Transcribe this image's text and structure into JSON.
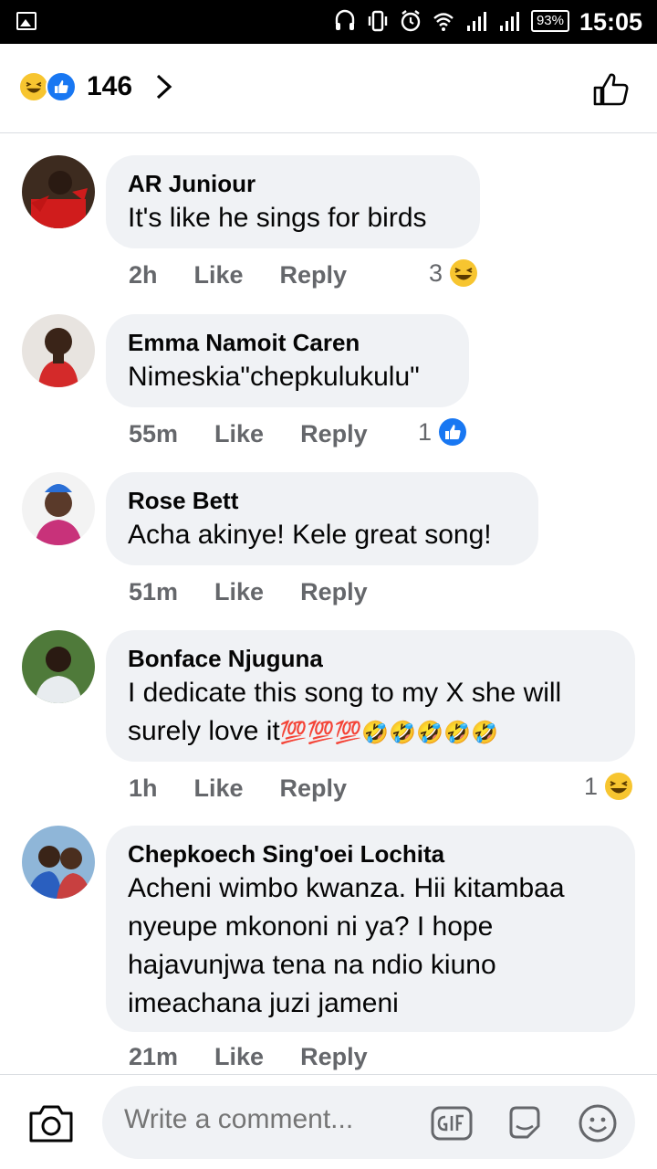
{
  "status_bar": {
    "battery": "93%",
    "time": "15:05"
  },
  "header": {
    "reaction_count": "146",
    "reaction_icons": [
      "haha-emoji",
      "like-emoji"
    ]
  },
  "comments": [
    {
      "name": "AR Juniour",
      "text": "It's like he sings for birds",
      "time": "2h",
      "like_label": "Like",
      "reply_label": "Reply",
      "reaction_count": "3",
      "reaction_icon": "haha-emoji"
    },
    {
      "name": "Emma Namoit Caren",
      "text": "Nimeskia\"chepkulukulu\"",
      "time": "55m",
      "like_label": "Like",
      "reply_label": "Reply",
      "reaction_count": "1",
      "reaction_icon": "like-emoji"
    },
    {
      "name": "Rose Bett",
      "text": "Acha akinye! Kele great song!",
      "time": "51m",
      "like_label": "Like",
      "reply_label": "Reply"
    },
    {
      "name": "Bonface Njuguna",
      "text_line1": "I dedicate this song to my X she will",
      "text_line2": "surely love it",
      "text_emojis": [
        "💯",
        "💯",
        "💯",
        "🤣",
        "🤣",
        "🤣",
        "🤣",
        "🤣"
      ],
      "time": "1h",
      "like_label": "Like",
      "reply_label": "Reply",
      "reaction_count": "1",
      "reaction_icon": "haha-emoji"
    },
    {
      "name": "Chepkoech Sing'oei Lochita",
      "text_lines": [
        "Acheni wimbo kwanza. Hii kitambaa",
        "nyeupe mkononi ni ya? I hope",
        "hajavunjwa tena na ndio kiuno",
        "imeachana juzi jameni"
      ],
      "time": "21m",
      "like_label": "Like",
      "reply_label": "Reply"
    }
  ],
  "composer": {
    "placeholder": "Write a comment...",
    "icons": [
      "camera-icon",
      "gif-icon",
      "sticker-icon",
      "emoji-icon"
    ]
  },
  "colors": {
    "accent": "#1877f2",
    "bubble": "#f0f2f5",
    "meta": "#65676b",
    "haha": "#f7c530"
  }
}
